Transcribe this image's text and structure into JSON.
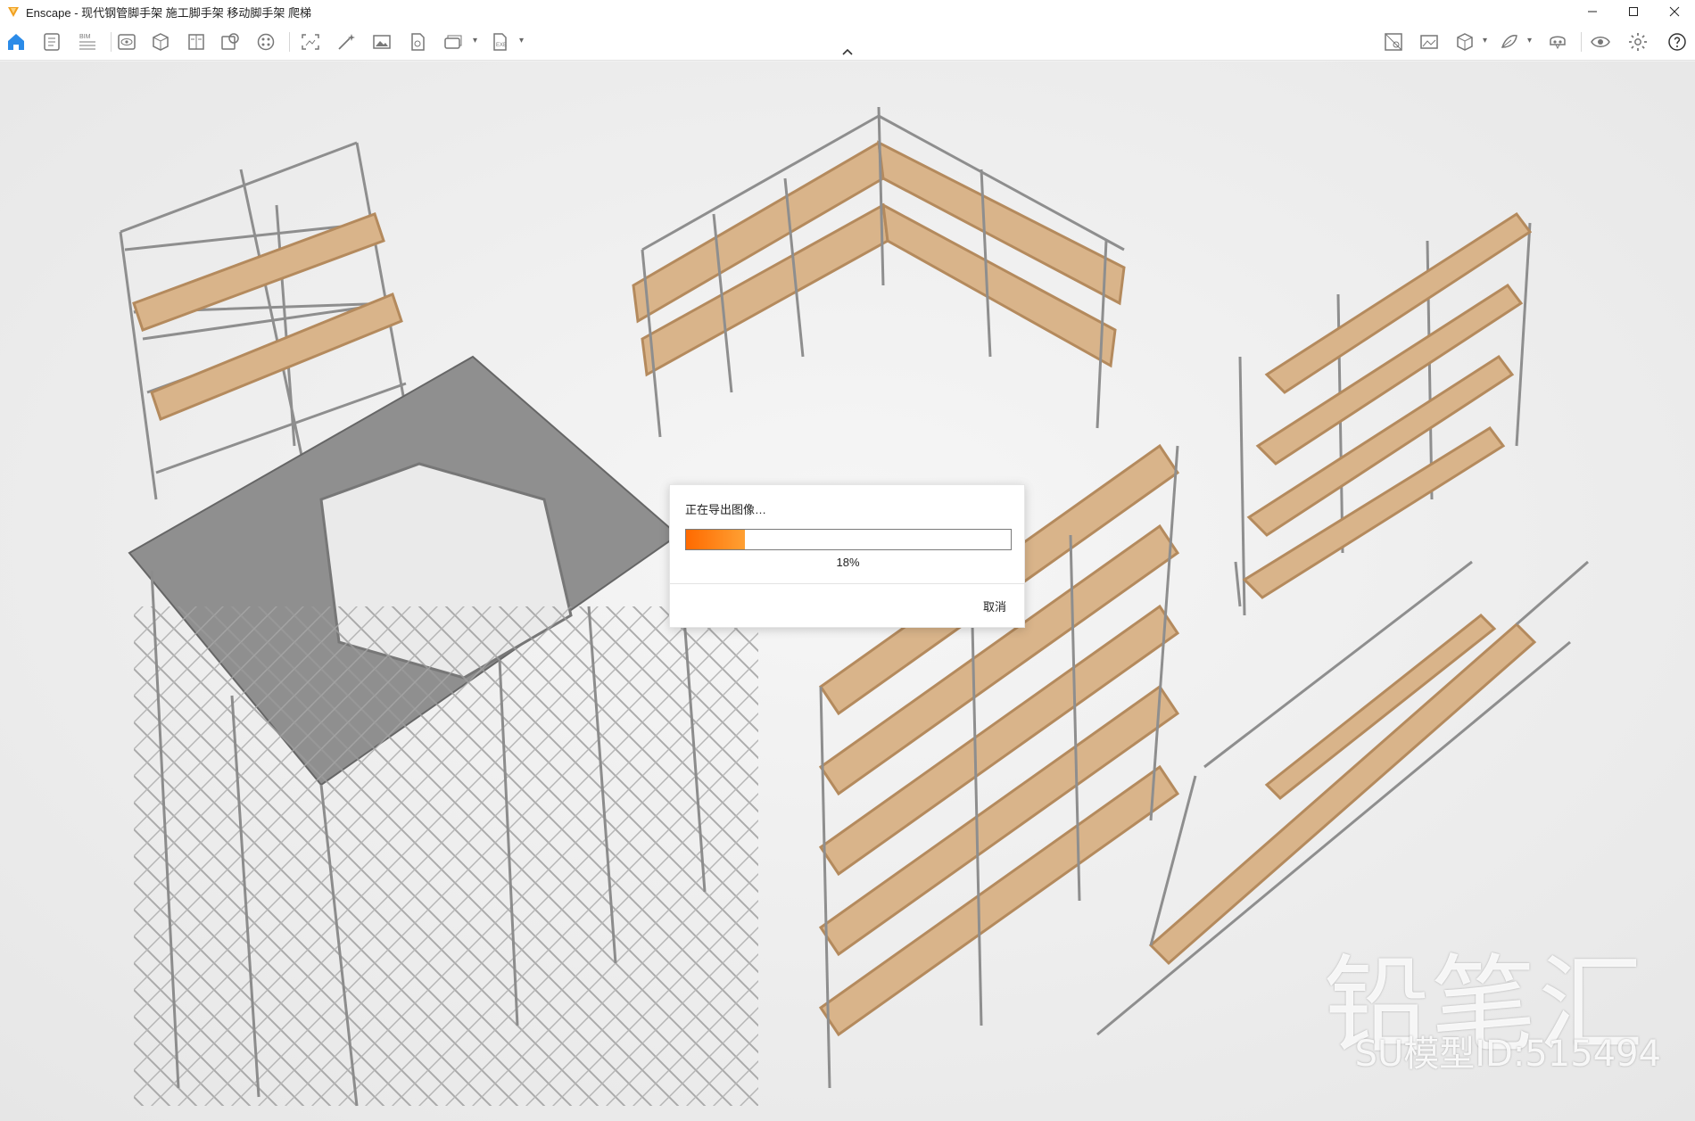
{
  "window": {
    "app_name": "Enscape",
    "title": "Enscape - 现代钢管脚手架 施工脚手架 移动脚手架 爬梯",
    "controls": [
      "minimize",
      "maximize",
      "close"
    ]
  },
  "toolbar": {
    "left_icons": [
      "home-icon",
      "document-icon",
      "bim-icon",
      "eye-frame-icon",
      "cube-map-icon",
      "book-icon",
      "asset-library-icon",
      "palette-icon",
      "screenshot-icon",
      "magic-icon",
      "image-icon",
      "panorama-icon",
      "batch-render-icon",
      "export-exe-icon"
    ],
    "bim_label": "BIM",
    "right_icons": [
      "site-context-icon",
      "image-settings-icon",
      "view-cube-icon",
      "material-icon",
      "vr-icon",
      "visibility-icon",
      "settings-icon",
      "help-icon"
    ]
  },
  "dialog": {
    "message": "正在导出图像…",
    "progress": 0.18,
    "progress_text": "18%",
    "cancel_label": "取消"
  },
  "watermark": {
    "brand": "铅笔汇",
    "model_id": "SU模型ID:515494"
  },
  "colors": {
    "accent": "#ff6a00",
    "home_icon": "#2b8be8",
    "app_icon": "#f0a020"
  }
}
